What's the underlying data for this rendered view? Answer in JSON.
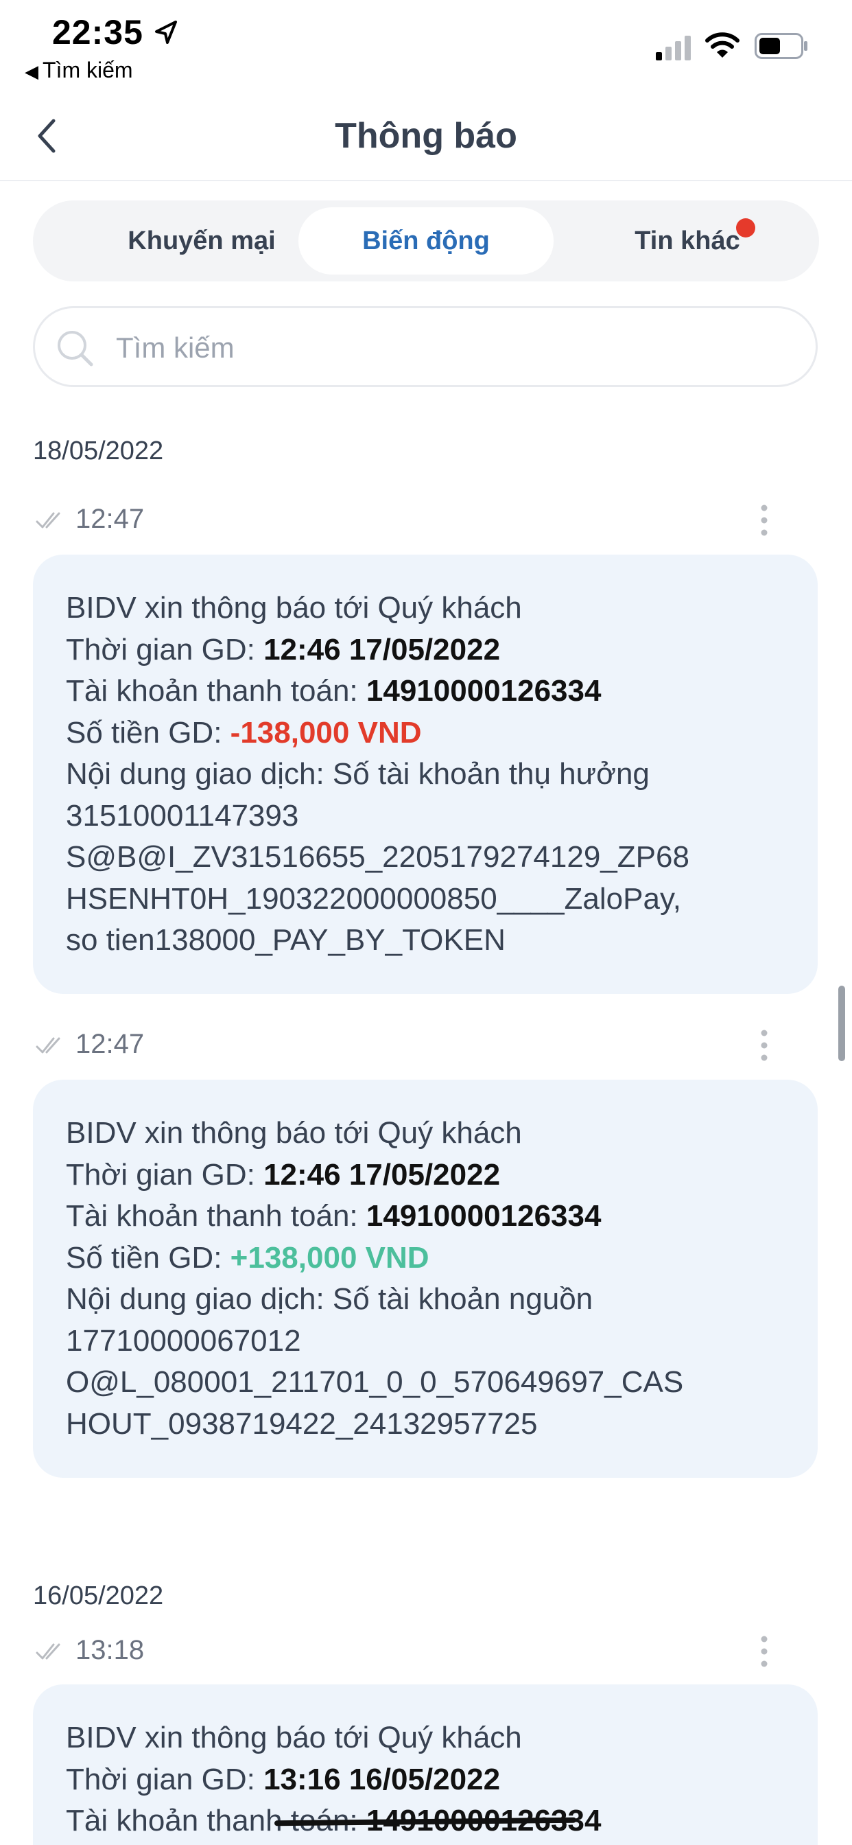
{
  "status_bar": {
    "time": "22:35",
    "back_app_label": "Tìm kiếm",
    "icons": [
      "location-arrow-icon",
      "signal-icon",
      "wifi-icon",
      "battery-icon"
    ]
  },
  "nav": {
    "title": "Thông báo",
    "back_icon": "chevron-left-icon"
  },
  "tabs": [
    {
      "label": "Khuyến mại",
      "active": false
    },
    {
      "label": "Biến động",
      "active": true
    },
    {
      "label": "Tin khác",
      "active": false,
      "has_badge": true
    }
  ],
  "search": {
    "placeholder": "Tìm kiếm",
    "value": ""
  },
  "colors": {
    "active_tab": "#2a6cb6",
    "negative": "#e23b2a",
    "positive": "#4cbf9c",
    "badge": "#e53a2b",
    "card_bg": "#eef4fb"
  },
  "feed": [
    {
      "date": "18/05/2022",
      "items": [
        {
          "time": "12:47",
          "greeting": "BIDV xin thông báo tới Quý khách",
          "time_label": "Thời gian GD: ",
          "time_value": "12:46 17/05/2022",
          "account_label": "Tài khoản thanh toán: ",
          "account_value": "14910000126334",
          "amount_label": "Số tiền GD: ",
          "amount_value": "-138,000 VND",
          "content_lines": [
            "Nội dung giao dịch: Số tài khoản thụ hưởng",
            "31510001147393",
            "S@B@I_ZV31516655_2205179274129_ZP68",
            "HSENHT0H_190322000000850____ZaloPay,",
            "so tien138000_PAY_BY_TOKEN"
          ]
        },
        {
          "time": "12:47",
          "greeting": "BIDV xin thông báo tới Quý khách",
          "time_label": "Thời gian GD: ",
          "time_value": "12:46 17/05/2022",
          "account_label": "Tài khoản thanh toán: ",
          "account_value": "14910000126334",
          "amount_label": "Số tiền GD: ",
          "amount_value": "+138,000 VND",
          "content_lines": [
            "Nội dung giao dịch: Số tài khoản nguồn",
            "17710000067012",
            "O@L_080001_211701_0_0_570649697_CAS",
            "HOUT_0938719422_24132957725"
          ]
        }
      ]
    },
    {
      "date": "16/05/2022",
      "items": [
        {
          "time": "13:18",
          "greeting": "BIDV xin thông báo tới Quý khách",
          "time_label": "Thời gian GD: ",
          "time_value": "13:16 16/05/2022",
          "account_label": "Tài khoản thanh toán: ",
          "account_value": "14910000126334"
        }
      ]
    }
  ]
}
